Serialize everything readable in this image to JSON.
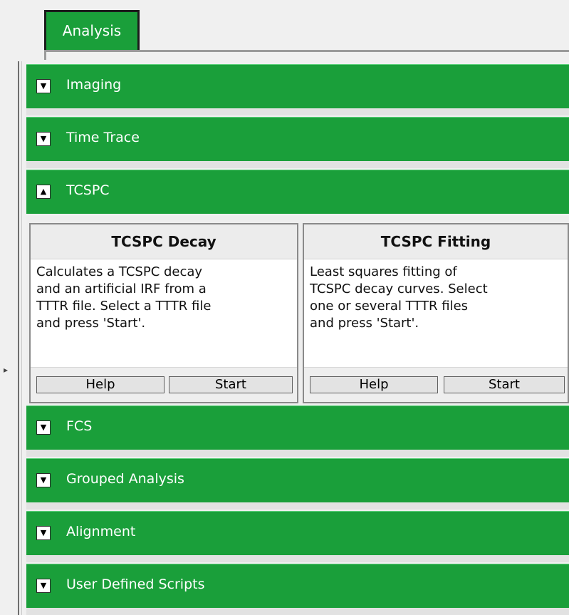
{
  "tab": {
    "label": "Analysis"
  },
  "sections": [
    {
      "label": "Imaging",
      "toggle": "▼"
    },
    {
      "label": "Time Trace",
      "toggle": "▼"
    },
    {
      "label": "TCSPC",
      "toggle": "▲"
    },
    {
      "label": "FCS",
      "toggle": "▼"
    },
    {
      "label": "Grouped Analysis",
      "toggle": "▼"
    },
    {
      "label": "Alignment",
      "toggle": "▼"
    },
    {
      "label": "User Defined Scripts",
      "toggle": "▼"
    }
  ],
  "tcspc_cards": [
    {
      "title": "TCSPC Decay",
      "lines": [
        "Calculates a TCSPC decay",
        "and an artificial IRF from a",
        "TTTR file. Select a TTTR file",
        "and press 'Start'."
      ],
      "help_label": "Help",
      "start_label": "Start"
    },
    {
      "title": "TCSPC Fitting",
      "lines": [
        "Least squares fitting of",
        "TCSPC decay curves. Select",
        "one or several TTTR files",
        "and press 'Start'."
      ],
      "help_label": "Help",
      "start_label": "Start"
    }
  ],
  "colors": {
    "section_green": "#1a9f3a",
    "tab_border": "#1c1c1c"
  }
}
